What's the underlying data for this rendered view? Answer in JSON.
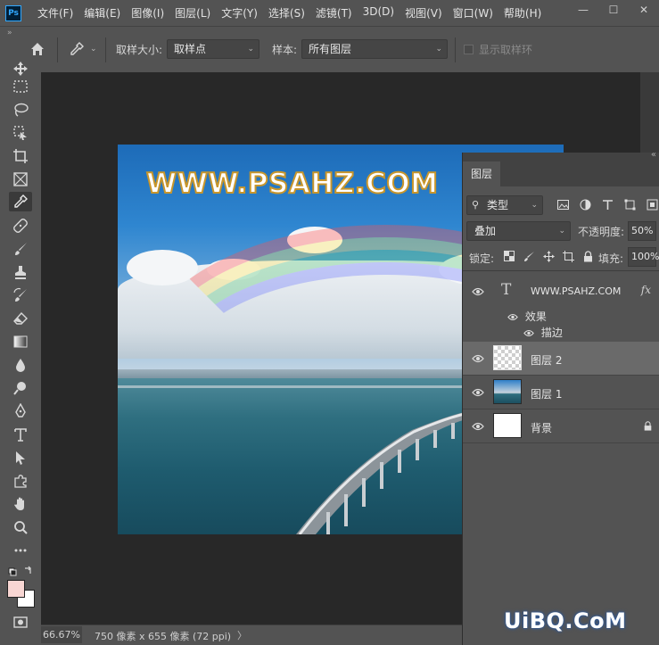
{
  "app": {
    "logo_text": "Ps",
    "menu": [
      "文件(F)",
      "编辑(E)",
      "图像(I)",
      "图层(L)",
      "文字(Y)",
      "选择(S)",
      "滤镜(T)",
      "3D(D)",
      "视图(V)",
      "窗口(W)",
      "帮助(H)"
    ],
    "window_controls": [
      "—",
      "☐",
      "✕"
    ]
  },
  "options": {
    "sample_size_label": "取样大小:",
    "sample_size_value": "取样点",
    "sample_label": "样本:",
    "sample_value": "所有图层",
    "show_ring_label": "显示取样环"
  },
  "canvas": {
    "text": "WWW.PSAHZ.COM"
  },
  "layers_panel": {
    "tab": "图层",
    "filter_value": "类型",
    "blend_mode": "叠加",
    "opacity_label": "不透明度:",
    "opacity_value": "50%",
    "lock_label": "锁定:",
    "fill_label": "填充:",
    "fill_value": "100%",
    "layers": [
      {
        "name": "WWW.PSAHZ.COM",
        "type": "text",
        "fx": "fx"
      },
      {
        "name": "图层 2",
        "type": "transparent",
        "selected": true
      },
      {
        "name": "图层 1",
        "type": "image"
      },
      {
        "name": "背景",
        "type": "background",
        "locked": true
      }
    ],
    "effects_label": "效果",
    "stroke_label": "描边"
  },
  "status": {
    "zoom": "66.67%",
    "doc_info": "750 像素 x 655 像素 (72 ppi)",
    "arrow": "〉"
  },
  "watermark": "UiBQ.CoM",
  "colors": {
    "foreground": "#f8d6d3",
    "background": "#ffffff",
    "text_stroke": "#c8962c"
  }
}
